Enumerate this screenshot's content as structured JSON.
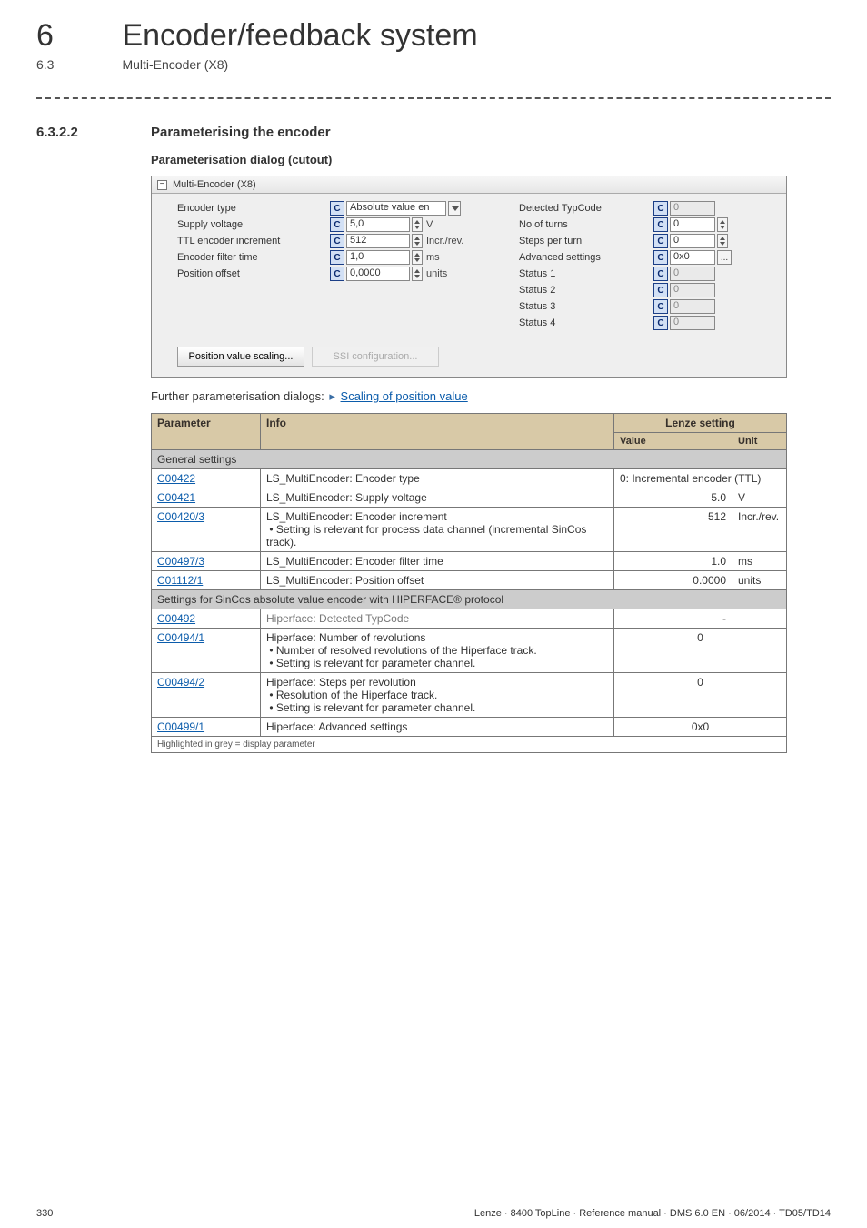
{
  "header": {
    "chapter_number": "6",
    "chapter_title": "Encoder/feedback system",
    "section_number": "6.3",
    "section_title": "Multi-Encoder (X8)"
  },
  "heading": {
    "number": "6.3.2.2",
    "title": "Parameterising the encoder",
    "dialog_caption": "Parameterisation dialog (cutout)"
  },
  "cutout": {
    "tree_toggle": "−",
    "title": "Multi-Encoder (X8)",
    "left": {
      "encoder_type": {
        "label": "Encoder type",
        "value": "Absolute value en"
      },
      "supply_voltage": {
        "label": "Supply voltage",
        "value": "5,0",
        "unit": "V"
      },
      "ttl_increment": {
        "label": "TTL encoder increment",
        "value": "512",
        "unit": "Incr./rev."
      },
      "filter_time": {
        "label": "Encoder filter time",
        "value": "1,0",
        "unit": "ms"
      },
      "position_offset": {
        "label": "Position offset",
        "value": "0,0000",
        "unit": "units"
      }
    },
    "right": {
      "detected_typcode": {
        "label": "Detected TypCode",
        "value": "0"
      },
      "no_of_turns": {
        "label": "No of turns",
        "value": "0"
      },
      "steps_per_turn": {
        "label": "Steps per turn",
        "value": "0"
      },
      "advanced_settings": {
        "label": "Advanced settings",
        "value": "0x0"
      },
      "status1": {
        "label": "Status 1",
        "value": "0"
      },
      "status2": {
        "label": "Status 2",
        "value": "0"
      },
      "status3": {
        "label": "Status 3",
        "value": "0"
      },
      "status4": {
        "label": "Status 4",
        "value": "0"
      }
    },
    "buttons": {
      "pos_scaling": "Position value scaling...",
      "ssi_config": "SSI configuration..."
    }
  },
  "further": {
    "prefix": "Further parameterisation dialogs: ",
    "link": "Scaling of position value"
  },
  "table": {
    "head": {
      "parameter": "Parameter",
      "info": "Info",
      "lenze": "Lenze setting",
      "value": "Value",
      "unit": "Unit"
    },
    "section1": "General settings",
    "rows1": [
      {
        "code": "C00422",
        "info": "LS_MultiEncoder: Encoder type",
        "value": "0: Incremental encoder (TTL)",
        "unit": "",
        "span": true
      },
      {
        "code": "C00421",
        "info": "LS_MultiEncoder: Supply voltage",
        "value": "5.0",
        "unit": "V"
      },
      {
        "code": "C00420/3",
        "info": "LS_MultiEncoder: Encoder increment\n• Setting is relevant for process data channel (incremental SinCos track).",
        "value": "512",
        "unit": "Incr./rev."
      },
      {
        "code": "C00497/3",
        "info": "LS_MultiEncoder: Encoder filter time",
        "value": "1.0",
        "unit": "ms"
      },
      {
        "code": "C01112/1",
        "info": "LS_MultiEncoder: Position offset",
        "value": "0.0000",
        "unit": "units"
      }
    ],
    "section2": "Settings for SinCos absolute value encoder with HIPERFACE® protocol",
    "rows2": [
      {
        "code": "C00492",
        "info": "Hiperface: Detected TypCode",
        "value": "-",
        "unit": "",
        "grey": true
      },
      {
        "code": "C00494/1",
        "info": "Hiperface: Number of revolutions\n• Number of resolved revolutions of the Hiperface track.\n• Setting is relevant for parameter channel.",
        "value": "0",
        "unit": "",
        "span": true,
        "valcenter": true
      },
      {
        "code": "C00494/2",
        "info": "Hiperface: Steps per revolution\n• Resolution of the Hiperface track.\n• Setting is relevant for parameter channel.",
        "value": "0",
        "unit": "",
        "span": true,
        "valcenter": true
      },
      {
        "code": "C00499/1",
        "info": "Hiperface: Advanced settings",
        "value": "0x0",
        "unit": "",
        "span": true,
        "valcenter": true
      }
    ],
    "footnote": "Highlighted in grey = display parameter"
  },
  "footer": {
    "page": "330",
    "doc": "Lenze · 8400 TopLine · Reference manual · DMS 6.0 EN · 06/2014 · TD05/TD14"
  }
}
